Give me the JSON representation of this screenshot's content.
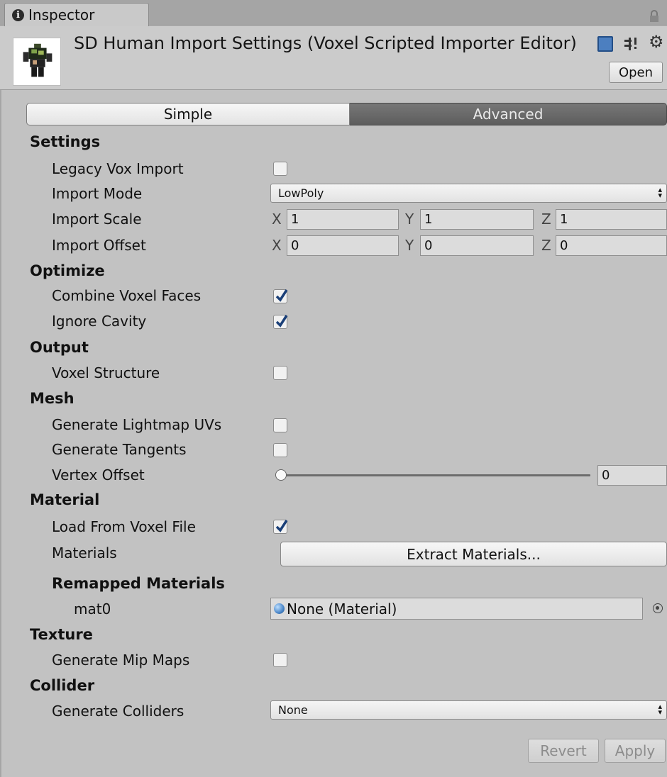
{
  "tab": {
    "label": "Inspector"
  },
  "header": {
    "title": "SD Human Import Settings (Voxel Scripted Importer Editor)",
    "open_label": "Open"
  },
  "mode_toggle": {
    "simple": "Simple",
    "advanced": "Advanced",
    "selected": "Advanced"
  },
  "sections": {
    "settings": "Settings",
    "optimize": "Optimize",
    "output": "Output",
    "mesh": "Mesh",
    "material": "Material",
    "remapped": "Remapped Materials",
    "texture": "Texture",
    "collider": "Collider"
  },
  "fields": {
    "legacy_vox_import": {
      "label": "Legacy Vox Import",
      "checked": false
    },
    "import_mode": {
      "label": "Import Mode",
      "value": "LowPoly"
    },
    "import_scale": {
      "label": "Import Scale",
      "x": "1",
      "y": "1",
      "z": "1"
    },
    "import_offset": {
      "label": "Import Offset",
      "x": "0",
      "y": "0",
      "z": "0"
    },
    "combine_voxel_faces": {
      "label": "Combine Voxel Faces",
      "checked": true
    },
    "ignore_cavity": {
      "label": "Ignore Cavity",
      "checked": true
    },
    "voxel_structure": {
      "label": "Voxel Structure",
      "checked": false
    },
    "generate_lightmap_uvs": {
      "label": "Generate Lightmap UVs",
      "checked": false
    },
    "generate_tangents": {
      "label": "Generate Tangents",
      "checked": false
    },
    "vertex_offset": {
      "label": "Vertex Offset",
      "value": "0",
      "fraction": 0
    },
    "load_from_voxel_file": {
      "label": "Load From Voxel File",
      "checked": true
    },
    "materials": {
      "label": "Materials",
      "button": "Extract Materials..."
    },
    "mat0": {
      "label": "mat0",
      "value": "None (Material)"
    },
    "generate_mip_maps": {
      "label": "Generate Mip Maps",
      "checked": false
    },
    "generate_colliders": {
      "label": "Generate Colliders",
      "value": "None"
    }
  },
  "axes": {
    "x": "X",
    "y": "Y",
    "z": "Z"
  },
  "footer": {
    "revert": "Revert",
    "apply": "Apply"
  },
  "colors": {
    "checkmark": "#1a3f78",
    "toggle_selected": "#686868"
  }
}
